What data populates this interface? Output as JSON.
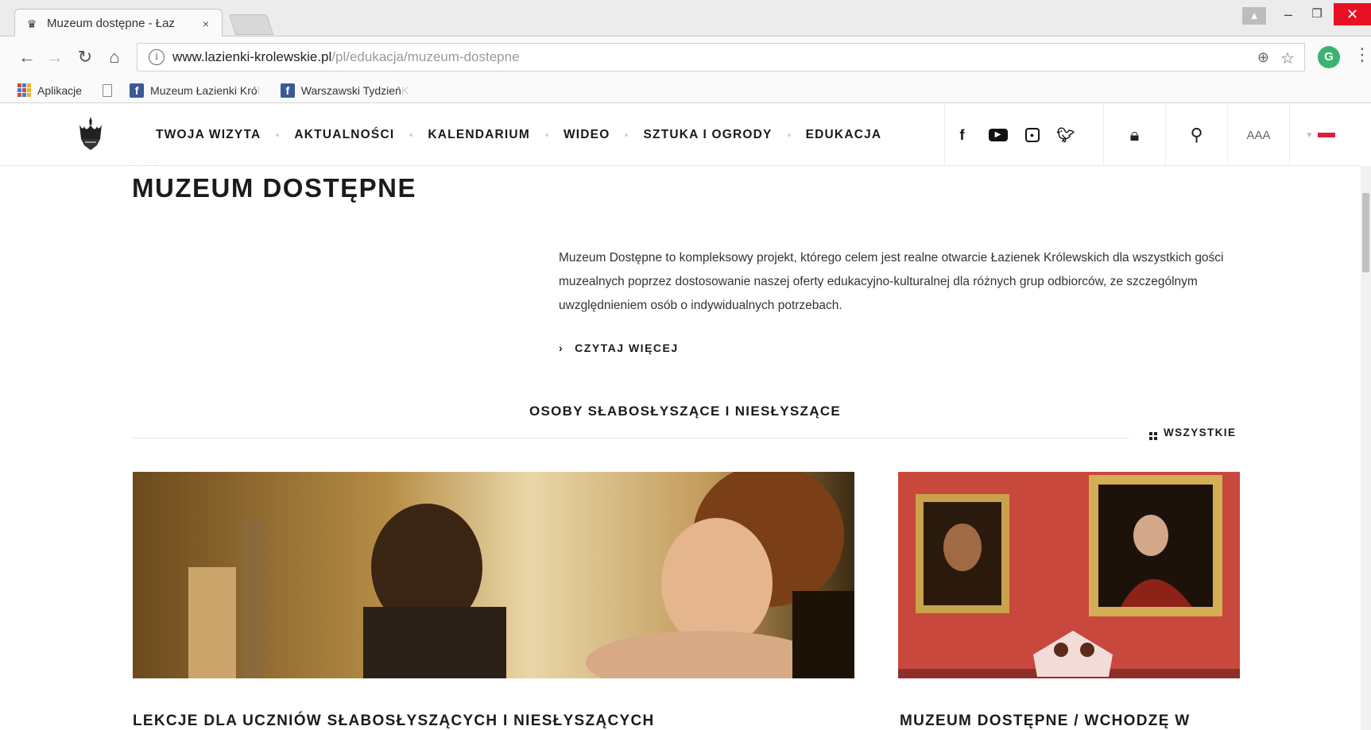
{
  "browser": {
    "tab_title": "Muzeum dostępne - Łaz",
    "tab_close": "×",
    "url_host": "www.lazienki-krolewskie.pl",
    "url_path": "/pl/edukacja/muzeum-dostepne",
    "bookmarks": {
      "apps": "Aplikacje",
      "item1": "Muzeum Łazienki Kró",
      "item1_fade": "l",
      "item2": "Warszawski Tydzień",
      "item2_fade": " K"
    },
    "extension_label": "G"
  },
  "site": {
    "nav": [
      "TWOJA WIZYTA",
      "AKTUALNOŚCI",
      "KALENDARIUM",
      "WIDEO",
      "SZTUKA I OGRODY",
      "EDUKACJA"
    ],
    "font_size_label": "AAA",
    "social_icons": [
      "facebook-icon",
      "youtube-icon",
      "instagram-icon",
      "twitter-icon"
    ]
  },
  "page": {
    "title": "MUZEUM DOSTĘPNE",
    "intro": "Muzeum Dostępne to kompleksowy projekt, którego celem jest realne otwarcie Łazienek Królewskich dla wszystkich gości muzealnych poprzez dostosowanie naszej oferty edukacyjno-kulturalnej dla różnych grup odbiorców, ze szczególnym uwzględnieniem osób o indywidualnych potrzebach.",
    "read_more": "CZYTAJ WIĘCEJ",
    "section_title": "OSOBY SŁABOSŁYSZĄCE I NIESŁYSZĄCE",
    "all_label": "WSZYSTKIE",
    "cards": [
      {
        "title": "LEKCJE DLA UCZNIÓW SŁABOSŁYSZĄCYCH I NIESŁYSZĄCYCH"
      },
      {
        "title": "MUZEUM DOSTĘPNE / WCHODZĘ W"
      }
    ]
  },
  "colors": {
    "flag_red": "#dd1f3c",
    "close_red": "#e81123",
    "facebook_blue": "#3b5998"
  }
}
